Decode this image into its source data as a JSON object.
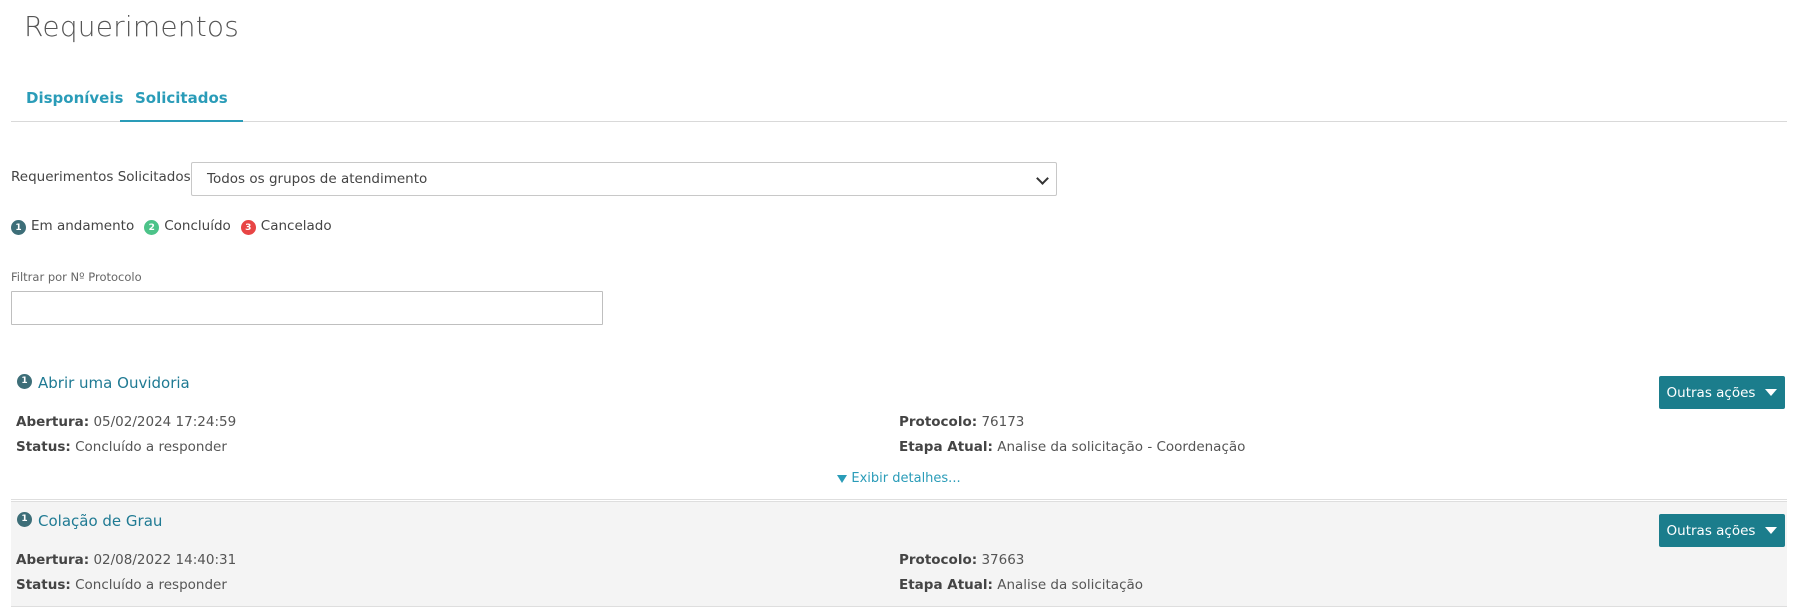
{
  "page": {
    "title": "Requerimentos"
  },
  "tabs": [
    {
      "label": "Disponíveis",
      "active": false
    },
    {
      "label": "Solicitados",
      "active": true
    }
  ],
  "filter": {
    "label": "Requerimentos Solicitados:",
    "selected": "Todos os grupos de atendimento"
  },
  "legend": [
    {
      "number": "1",
      "label": "Em andamento",
      "color": "#3d6e78"
    },
    {
      "number": "2",
      "label": "Concluído",
      "color": "#4cc389"
    },
    {
      "number": "3",
      "label": "Cancelado",
      "color": "#e84545"
    }
  ],
  "protocol_filter": {
    "label": "Filtrar por Nº Protocolo",
    "value": ""
  },
  "labels": {
    "opening": "Abertura:",
    "status": "Status:",
    "protocol": "Protocolo:",
    "stage": "Etapa Atual:",
    "actions": "Outras ações",
    "details": "Exibir detalhes..."
  },
  "requests": [
    {
      "badge": "1",
      "title": "Abrir uma Ouvidoria",
      "opening": "05/02/2024 17:24:59",
      "status": "Concluído a responder",
      "protocol": "76173",
      "stage": "Analise da solicitação - Coordenação"
    },
    {
      "badge": "1",
      "title": "Colação de Grau",
      "opening": "02/08/2022 14:40:31",
      "status": "Concluído a responder",
      "protocol": "37663",
      "stage": "Analise da solicitação"
    }
  ],
  "colors": {
    "accent": "#2a9cb8",
    "button": "#1b7d8c"
  }
}
